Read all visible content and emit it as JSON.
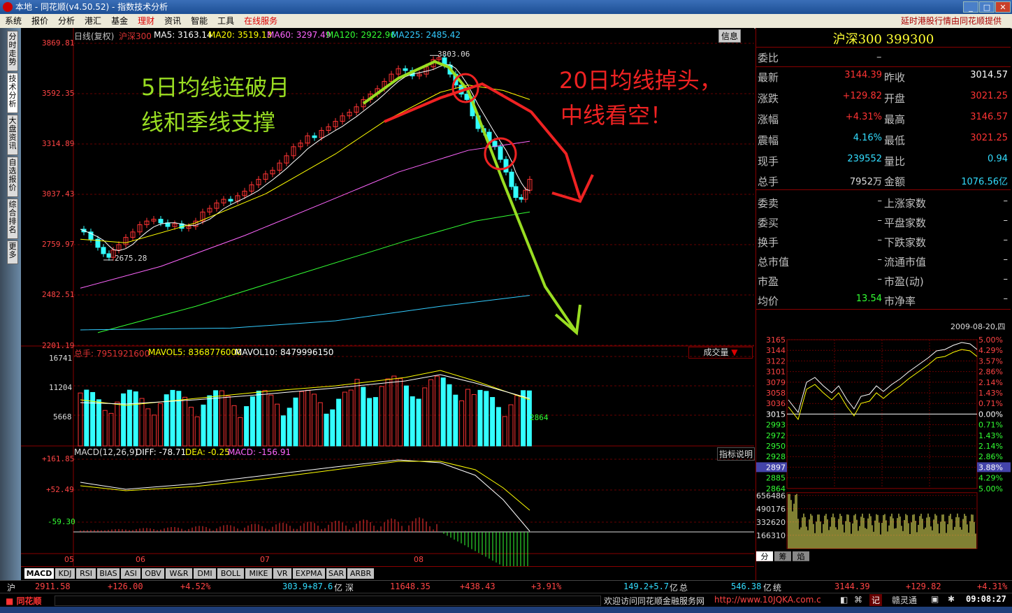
{
  "window": {
    "title": "本地 - 同花顺(v4.50.52) - 指数技术分析"
  },
  "menu": {
    "items": [
      "系统",
      "报价",
      "分析",
      "港汇",
      "基金",
      "理财",
      "资讯",
      "智能",
      "工具",
      "在线服务"
    ],
    "right": "延时港股行情由同花顺提供"
  },
  "left_tabs": [
    "分时走势",
    "技术分析",
    "大盘资讯",
    "自选报价",
    "综合排名",
    "更多"
  ],
  "chart": {
    "header": "日线(复权)",
    "symbol": "沪深300",
    "ma5": "MA5: 3163.14",
    "ma20": "MA20: 3519.13",
    "ma60": "MA60: 3297.49",
    "ma120": "MA120: 2922.96",
    "ma225": "MA225: 2485.42",
    "info_btn": "信息",
    "price_ticks": [
      "3869.81",
      "3592.35",
      "3314.89",
      "3037.43",
      "2759.97",
      "2482.51",
      "2201.19"
    ],
    "high_label": "3803.06",
    "low_label": "2675.28",
    "annotation_left": [
      "5日均线连破月",
      "线和季线支撑"
    ],
    "annotation_right": [
      "20日均线掉头，",
      "中线看空！"
    ],
    "x_labels": [
      "05",
      "06",
      "07",
      "08"
    ]
  },
  "volume": {
    "header": "总手: 7951921600",
    "mavol5": "MAVOL5: 8368776000",
    "mavol10": "MAVOL10: 8479996150",
    "selector": "成交量",
    "ticks": [
      "16741",
      "11204",
      "5668"
    ],
    "side_value": "2864"
  },
  "macd": {
    "header": "MACD(12,26,9)",
    "diff": "DIFF: -78.71",
    "dea": "DEA: -0.25",
    "macd": "MACD: -156.91",
    "btn": "指标说明",
    "ticks": [
      "+161.85",
      "+52.49",
      "-59.30"
    ]
  },
  "indicator_tabs": [
    "MACD",
    "KDJ",
    "RSI",
    "BIAS",
    "ASI",
    "OBV",
    "W&R",
    "DMI",
    "BOLL",
    "MIKE",
    "VR",
    "EXPMA",
    "SAR",
    "ARBR"
  ],
  "quote": {
    "title": "沪深300 399300",
    "weibi_label": "委比",
    "weibi_value": "–",
    "rows": [
      {
        "l1": "最新",
        "v1": "3144.39",
        "l2": "昨收",
        "v2": "3014.57",
        "c1": "#ff3333",
        "c2": "#ffffff"
      },
      {
        "l1": "涨跌",
        "v1": "+129.82",
        "l2": "开盘",
        "v2": "3021.25",
        "c1": "#ff3333",
        "c2": "#ff3333"
      },
      {
        "l1": "涨幅",
        "v1": "+4.31%",
        "l2": "最高",
        "v2": "3146.57",
        "c1": "#ff3333",
        "c2": "#ff3333"
      },
      {
        "l1": "震幅",
        "v1": "4.16%",
        "l2": "最低",
        "v2": "3021.25",
        "c1": "#33ddff",
        "c2": "#ff3333"
      },
      {
        "l1": "现手",
        "v1": "239552",
        "l2": "量比",
        "v2": "0.94",
        "c1": "#33ddff",
        "c2": "#33ddff"
      },
      {
        "l1": "总手",
        "v1": "7952万",
        "l2": "金额",
        "v2": "1076.56亿",
        "c1": "#dddddd",
        "c2": "#33ddff"
      },
      {
        "l1": "委卖",
        "v1": "–",
        "l2": "上涨家数",
        "v2": "–",
        "c1": "#dddddd",
        "c2": "#dddddd"
      },
      {
        "l1": "委买",
        "v1": "–",
        "l2": "平盘家数",
        "v2": "–",
        "c1": "#dddddd",
        "c2": "#dddddd"
      },
      {
        "l1": "换手",
        "v1": "–",
        "l2": "下跌家数",
        "v2": "–",
        "c1": "#dddddd",
        "c2": "#dddddd"
      },
      {
        "l1": "总市值",
        "v1": "–",
        "l2": "流通市值",
        "v2": "–",
        "c1": "#dddddd",
        "c2": "#dddddd"
      },
      {
        "l1": "市盈",
        "v1": "–",
        "l2": "市盈(动)",
        "v2": "–",
        "c1": "#dddddd",
        "c2": "#dddddd"
      },
      {
        "l1": "均价",
        "v1": "13.54",
        "l2": "市净率",
        "v2": "–",
        "c1": "#33ff33",
        "c2": "#dddddd"
      }
    ]
  },
  "intraday": {
    "date": "2009-08-20,四",
    "left_ticks": [
      "3165",
      "3144",
      "3122",
      "3101",
      "3079",
      "3058",
      "3036",
      "3015",
      "2993",
      "2972",
      "2950",
      "2928",
      "2907",
      "2885",
      "2864"
    ],
    "right_ticks": [
      "5.00%",
      "4.29%",
      "3.57%",
      "2.86%",
      "2.14%",
      "1.43%",
      "0.71%",
      "0.00%",
      "0.71%",
      "1.43%",
      "2.14%",
      "2.86%",
      "3.57%",
      "4.29%",
      "5.00%"
    ],
    "highlight_left": "2897",
    "highlight_right": "3.88%",
    "vol_ticks": [
      "656486",
      "490176",
      "332620",
      "166310"
    ],
    "tabs": [
      "分",
      "筹",
      "焰"
    ]
  },
  "status": {
    "sh_label": "沪",
    "sh_price": "2911.58",
    "sh_chg": "+126.00",
    "sh_pct": "+4.52%",
    "sh_amt": "303.9+87.6",
    "sh_unit": "亿",
    "sz_label": "深",
    "sz_price": "11648.35",
    "sz_chg": "+438.43",
    "sz_pct": "+3.91%",
    "sz_amt": "149.2+5.7",
    "sz_unit": "亿",
    "zong_label": "总",
    "zong_amt": "546.38",
    "zong_unit": "亿",
    "tong_label": "统",
    "hs_price": "3144.39",
    "hs_chg": "+129.82",
    "hs_pct": "+4.31%"
  },
  "bottom": {
    "brand": "同花顺",
    "welcome": "欢迎访问同花顺金融服务网",
    "url": "http://www.10JQKA.com.c",
    "btn1": "记",
    "btn2": "赣灵通",
    "clock": "09:08:27"
  },
  "chart_data": {
    "type": "candlestick",
    "ylim": [
      2201.19,
      3869.81
    ],
    "high": 3803.06,
    "low": 2675.28,
    "x_labels": [
      "05",
      "06",
      "07",
      "08"
    ]
  }
}
